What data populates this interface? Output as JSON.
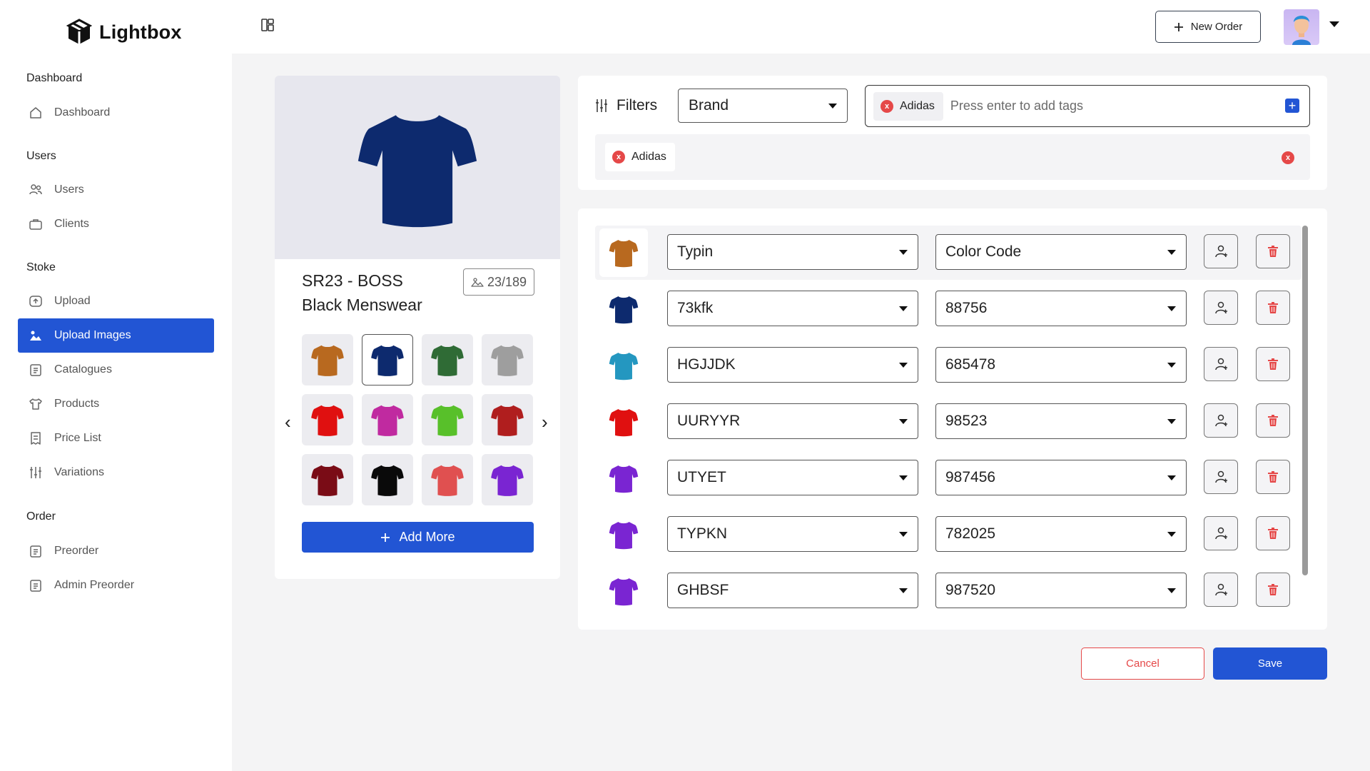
{
  "app": {
    "name": "Lightbox"
  },
  "sidebar": {
    "sections": [
      {
        "label": "Dashboard"
      },
      {
        "label": "Users"
      },
      {
        "label": "Stoke"
      },
      {
        "label": "Order"
      }
    ],
    "items": [
      {
        "label": "Dashboard",
        "icon": "home-icon"
      },
      {
        "label": "Users",
        "icon": "users-icon"
      },
      {
        "label": "Clients",
        "icon": "briefcase-icon"
      },
      {
        "label": "Upload",
        "icon": "upload-icon"
      },
      {
        "label": "Upload Images",
        "icon": "image-upload-icon",
        "active": true
      },
      {
        "label": "Catalogues",
        "icon": "clipboard-icon"
      },
      {
        "label": "Products",
        "icon": "tshirt-icon"
      },
      {
        "label": "Price List",
        "icon": "receipt-icon"
      },
      {
        "label": "Variations",
        "icon": "sliders-icon"
      },
      {
        "label": "Preorder",
        "icon": "clipboard-icon"
      },
      {
        "label": "Admin Preorder",
        "icon": "clipboard-icon"
      }
    ]
  },
  "topbar": {
    "new_order_label": "New Order"
  },
  "product": {
    "title_line1": "SR23 - BOSS",
    "title_line2": "Black Menswear",
    "count": "23/189",
    "hero_color": "#0d2a6e",
    "thumbnails": [
      {
        "color": "#b8691f"
      },
      {
        "color": "#0d2a6e",
        "selected": true
      },
      {
        "color": "#2f6b35"
      },
      {
        "color": "#9e9e9e"
      },
      {
        "color": "#e01010"
      },
      {
        "color": "#c02aa0"
      },
      {
        "color": "#58c02a"
      },
      {
        "color": "#b01e1e"
      },
      {
        "color": "#7a0c16"
      },
      {
        "color": "#0a0a0a"
      },
      {
        "color": "#e05050"
      },
      {
        "color": "#7a25d2"
      }
    ],
    "add_more_label": "Add More"
  },
  "filters": {
    "label": "Filters",
    "brand_select": "Brand",
    "tag_chip": "Adidas",
    "tag_placeholder": "Press enter to add tags",
    "active_tag": "Adidas"
  },
  "variants": [
    {
      "color": "#b8691f",
      "type": "Typin",
      "code": "Color Code"
    },
    {
      "color": "#0d2a6e",
      "type": "73kfk",
      "code": "88756"
    },
    {
      "color": "#2497c0",
      "type": "HGJJDK",
      "code": "685478"
    },
    {
      "color": "#e01010",
      "type": "UURYYR",
      "code": "98523"
    },
    {
      "color": "#7a25d2",
      "type": "UTYET",
      "code": "987456"
    },
    {
      "color": "#7a25d2",
      "type": "TYPKN",
      "code": "782025"
    },
    {
      "color": "#7a25d2",
      "type": "GHBSF",
      "code": "987520"
    }
  ],
  "actions": {
    "cancel_label": "Cancel",
    "save_label": "Save"
  },
  "colors": {
    "accent": "#2255d4",
    "danger": "#e54848"
  }
}
